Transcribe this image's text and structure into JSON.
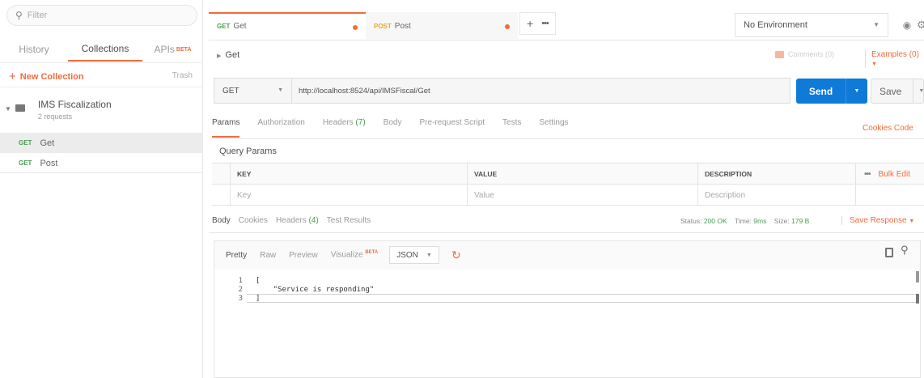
{
  "sidebar": {
    "filter_placeholder": "Filter",
    "tabs": [
      "History",
      "Collections",
      "APIs"
    ],
    "apis_badge": "BETA",
    "new_collection": "New Collection",
    "trash": "Trash",
    "collection": {
      "name": "IMS Fiscalization",
      "subtitle": "2 requests"
    },
    "requests": [
      {
        "method": "GET",
        "name": "Get"
      },
      {
        "method": "GET",
        "name": "Post"
      }
    ]
  },
  "tabs": [
    {
      "method": "GET",
      "name": "Get"
    },
    {
      "method": "POST",
      "name": "Post"
    }
  ],
  "tab_controls": {
    "add": "+",
    "more": "•••"
  },
  "environment": "No Environment",
  "request": {
    "title": "Get",
    "comments": "Comments (0)",
    "examples": "Examples (0)",
    "method": "GET",
    "url": "http://localhost:8524/api/IMSFiscal/Get",
    "send": "Send",
    "save": "Save"
  },
  "subtabs": {
    "params": "Params",
    "authorization": "Authorization",
    "headers": "Headers",
    "headers_count": "(7)",
    "body": "Body",
    "prerequest": "Pre-request Script",
    "tests": "Tests",
    "settings": "Settings",
    "cookies_code": "Cookies Code"
  },
  "query_params": {
    "title": "Query Params",
    "headers": [
      "KEY",
      "VALUE",
      "DESCRIPTION"
    ],
    "placeholders": [
      "Key",
      "Value",
      "Description"
    ],
    "bulk_edit": "Bulk Edit",
    "more": "•••"
  },
  "response": {
    "tabs": {
      "body": "Body",
      "cookies": "Cookies",
      "headers": "Headers",
      "headers_count": "(4)",
      "test_results": "Test Results"
    },
    "status_label": "Status:",
    "status_value": "200 OK",
    "time_label": "Time:",
    "time_value": "9ms",
    "size_label": "Size:",
    "size_value": "179 B",
    "save_response": "Save Response",
    "format": {
      "pretty": "Pretty",
      "raw": "Raw",
      "preview": "Preview",
      "visualize": "Visualize",
      "visualize_badge": "BETA",
      "type": "JSON"
    },
    "lines": [
      "1",
      "2",
      "3"
    ],
    "code": [
      "[",
      "    \"Service is responding\"",
      "]"
    ]
  },
  "colors": {
    "accent": "#f26b3a",
    "send": "#0f7ad8",
    "get": "#4a9d52",
    "post": "#e9a829"
  }
}
